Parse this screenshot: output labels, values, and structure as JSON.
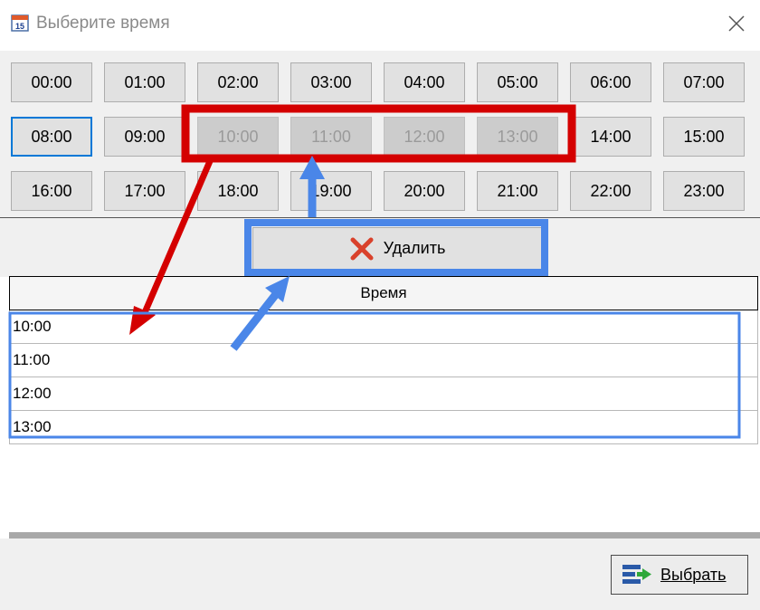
{
  "window": {
    "title": "Выберите время",
    "icon": "calendar-icon",
    "close_icon": "close-icon"
  },
  "time_buttons": [
    {
      "label": "00:00",
      "state": "normal"
    },
    {
      "label": "01:00",
      "state": "normal"
    },
    {
      "label": "02:00",
      "state": "normal"
    },
    {
      "label": "03:00",
      "state": "normal"
    },
    {
      "label": "04:00",
      "state": "normal"
    },
    {
      "label": "05:00",
      "state": "normal"
    },
    {
      "label": "06:00",
      "state": "normal"
    },
    {
      "label": "07:00",
      "state": "normal"
    },
    {
      "label": "08:00",
      "state": "focused"
    },
    {
      "label": "09:00",
      "state": "normal"
    },
    {
      "label": "10:00",
      "state": "disabled"
    },
    {
      "label": "11:00",
      "state": "disabled"
    },
    {
      "label": "12:00",
      "state": "disabled"
    },
    {
      "label": "13:00",
      "state": "disabled"
    },
    {
      "label": "14:00",
      "state": "normal"
    },
    {
      "label": "15:00",
      "state": "normal"
    },
    {
      "label": "16:00",
      "state": "normal"
    },
    {
      "label": "17:00",
      "state": "normal"
    },
    {
      "label": "18:00",
      "state": "normal"
    },
    {
      "label": "19:00",
      "state": "normal"
    },
    {
      "label": "20:00",
      "state": "normal"
    },
    {
      "label": "21:00",
      "state": "normal"
    },
    {
      "label": "22:00",
      "state": "normal"
    },
    {
      "label": "23:00",
      "state": "normal"
    }
  ],
  "toolbar": {
    "delete_label": "Удалить",
    "delete_icon": "red-x-icon"
  },
  "grid": {
    "column_header": "Время",
    "rows": [
      "10:00",
      "11:00",
      "12:00",
      "13:00"
    ]
  },
  "footer": {
    "select_label": "Выбрать",
    "select_icon": "add-to-list-icon"
  },
  "colors": {
    "annotation_red": "#d40000",
    "annotation_blue": "#4a86e8",
    "focus_blue": "#0078d7"
  }
}
